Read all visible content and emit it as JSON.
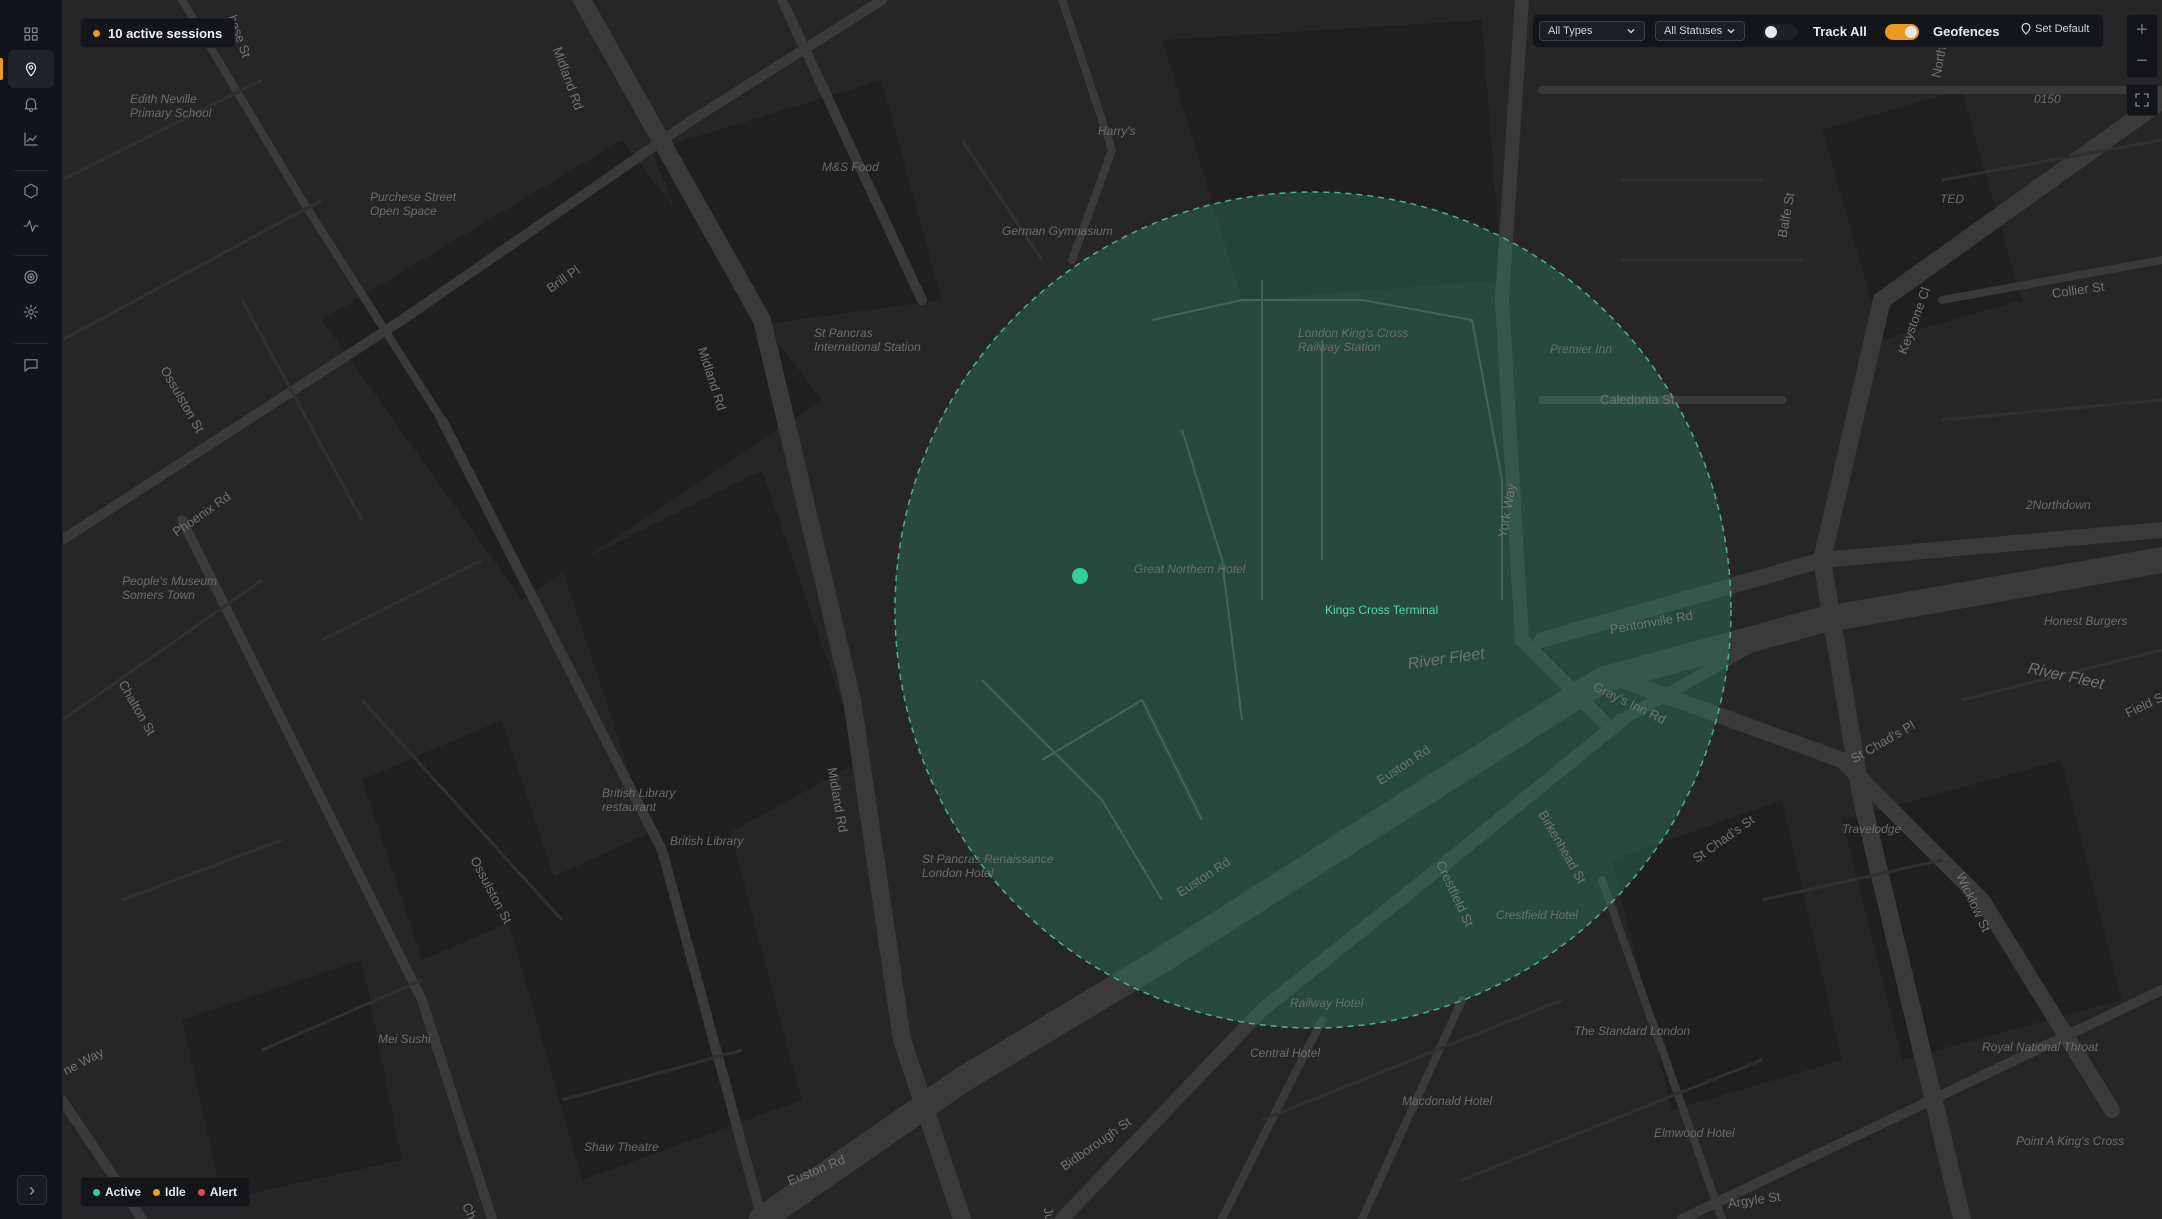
{
  "header": {
    "sessions_label": "10 active sessions",
    "sessions_dot_color": "#e89a1c"
  },
  "sidebar": {
    "items": [
      {
        "icon": "grid-icon",
        "name": "dashboard"
      },
      {
        "icon": "map-pin-icon",
        "name": "map",
        "active": true
      },
      {
        "icon": "bell-icon",
        "name": "alerts"
      },
      {
        "icon": "chart-line-icon",
        "name": "analytics"
      },
      {
        "icon": "hexagon-icon",
        "name": "geofences"
      },
      {
        "icon": "activity-icon",
        "name": "activity"
      },
      {
        "icon": "target-icon",
        "name": "tracking"
      },
      {
        "icon": "gear-icon",
        "name": "settings"
      },
      {
        "icon": "message-icon",
        "name": "messages"
      }
    ],
    "expand_label": "›"
  },
  "toolbar": {
    "type_filter": "All Types",
    "status_filter": "All Statuses",
    "track_all_label": "Track All",
    "track_all_on": false,
    "geofences_label": "Geofences",
    "geofences_on": true,
    "set_default_label": "Set Default"
  },
  "zoom": {
    "in": "+",
    "out": "−"
  },
  "geofence": {
    "name": "Kings Cross Terminal",
    "color": "#2f9c78"
  },
  "legend": [
    {
      "label": "Active",
      "color": "#2fd39a"
    },
    {
      "label": "Idle",
      "color": "#e8a21c"
    },
    {
      "label": "Alert",
      "color": "#e5484d"
    }
  ],
  "map_labels": {
    "places": [
      "Edith Neville Primary School",
      "Purchese Street Open Space",
      "M&S Food",
      "Harry's",
      "German Gymnasium",
      "St Pancras International Station",
      "London King's Cross Railway Station",
      "Premier Inn",
      "Great Northern Hotel",
      "People's Museum Somers Town",
      "British Library restaurant",
      "British Library",
      "St Pancras Renaissance London Hotel",
      "Crestfield Hotel",
      "Railway Hotel",
      "Central Hotel",
      "Macdonald Hotel",
      "The Standard London",
      "Elmwood Hotel",
      "Travelodge",
      "Royal National Throat",
      "Point A King's Cross",
      "Honest Burgers",
      "2Northdown",
      "Mei Sushi",
      "Shaw Theatre",
      "TED",
      "0150"
    ],
    "streets": [
      "Midland Rd",
      "Brill Pl",
      "Ossulston St",
      "Phoenix Rd",
      "Chalton St",
      "Euston Rd",
      "York Way",
      "Pentonville Rd",
      "Gray's Inn Rd",
      "Caledonia St",
      "Collier St",
      "Keystone Cl",
      "Birkenhead St",
      "Crestfield St",
      "St Chad's Pl",
      "Wicklow St",
      "Argyle St",
      "Bidborough St",
      "River Fleet",
      "Balfe St",
      "Northdown",
      "Field St",
      "Judd",
      "hese St",
      "ne Way",
      "Chalt"
    ]
  }
}
